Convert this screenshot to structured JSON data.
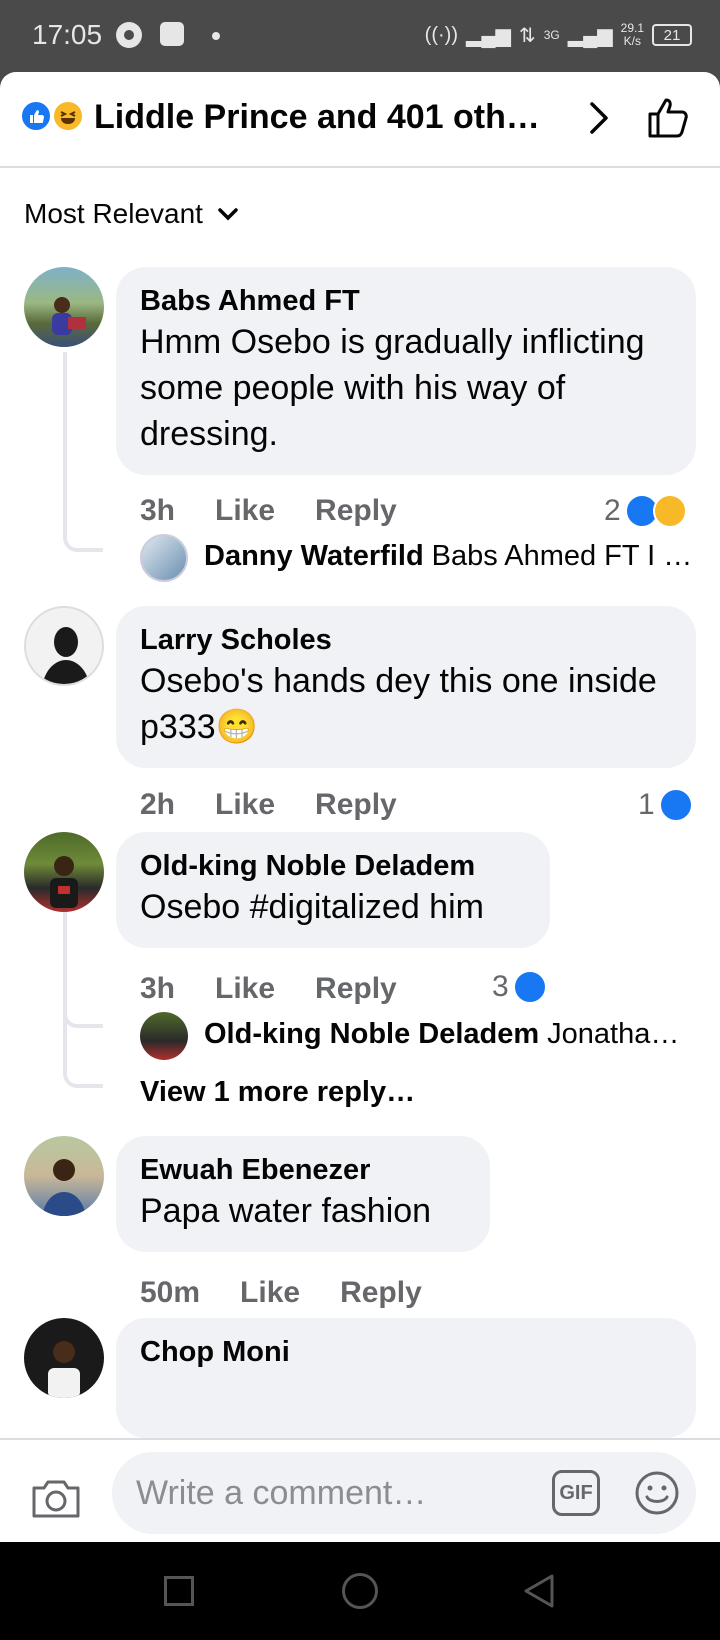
{
  "status_bar": {
    "time": "17:05",
    "speed": "29.1",
    "speed_unit": "K/s",
    "net": "3G",
    "battery": "21"
  },
  "header": {
    "title": "Liddle Prince and 401 oth…"
  },
  "sort": {
    "label": "Most Relevant"
  },
  "comments": [
    {
      "name": "Babs Ahmed FT",
      "text": "Hmm Osebo is gradually inflicting some people with his way of dressing.",
      "time": "3h",
      "like": "Like",
      "reply": "Reply",
      "reactions": "2",
      "replies": [
        {
          "name": "Danny Waterfild",
          "text": "Babs Ahmed FT I …"
        }
      ]
    },
    {
      "name": "Larry Scholes",
      "text": "Osebo's hands dey this one inside p333😁",
      "time": "2h",
      "like": "Like",
      "reply": "Reply",
      "reactions": "1"
    },
    {
      "name": "Old-king Noble Deladem",
      "text": "Osebo #digitalized him",
      "time": "3h",
      "like": "Like",
      "reply": "Reply",
      "reactions": "3",
      "replies": [
        {
          "name": "Old-king Noble Deladem",
          "text": "Jonatha…"
        }
      ],
      "more_replies": "View 1 more reply…"
    },
    {
      "name": "Ewuah Ebenezer",
      "text": "Papa water fashion",
      "time": "50m",
      "like": "Like",
      "reply": "Reply"
    },
    {
      "name": "Chop Moni"
    }
  ],
  "composer": {
    "placeholder": "Write a comment…",
    "gif_label": "GIF"
  },
  "colors": {
    "like_blue": "#1877f2",
    "haha_yellow": "#f7b928",
    "bubble": "#f0f2f5",
    "meta_gray": "#65676b"
  },
  "icons": [
    "like-reaction-icon",
    "haha-reaction-icon",
    "chevron-right-icon",
    "thumbs-up-icon",
    "chevron-down-icon",
    "camera-icon",
    "gif-icon",
    "emoji-icon"
  ]
}
